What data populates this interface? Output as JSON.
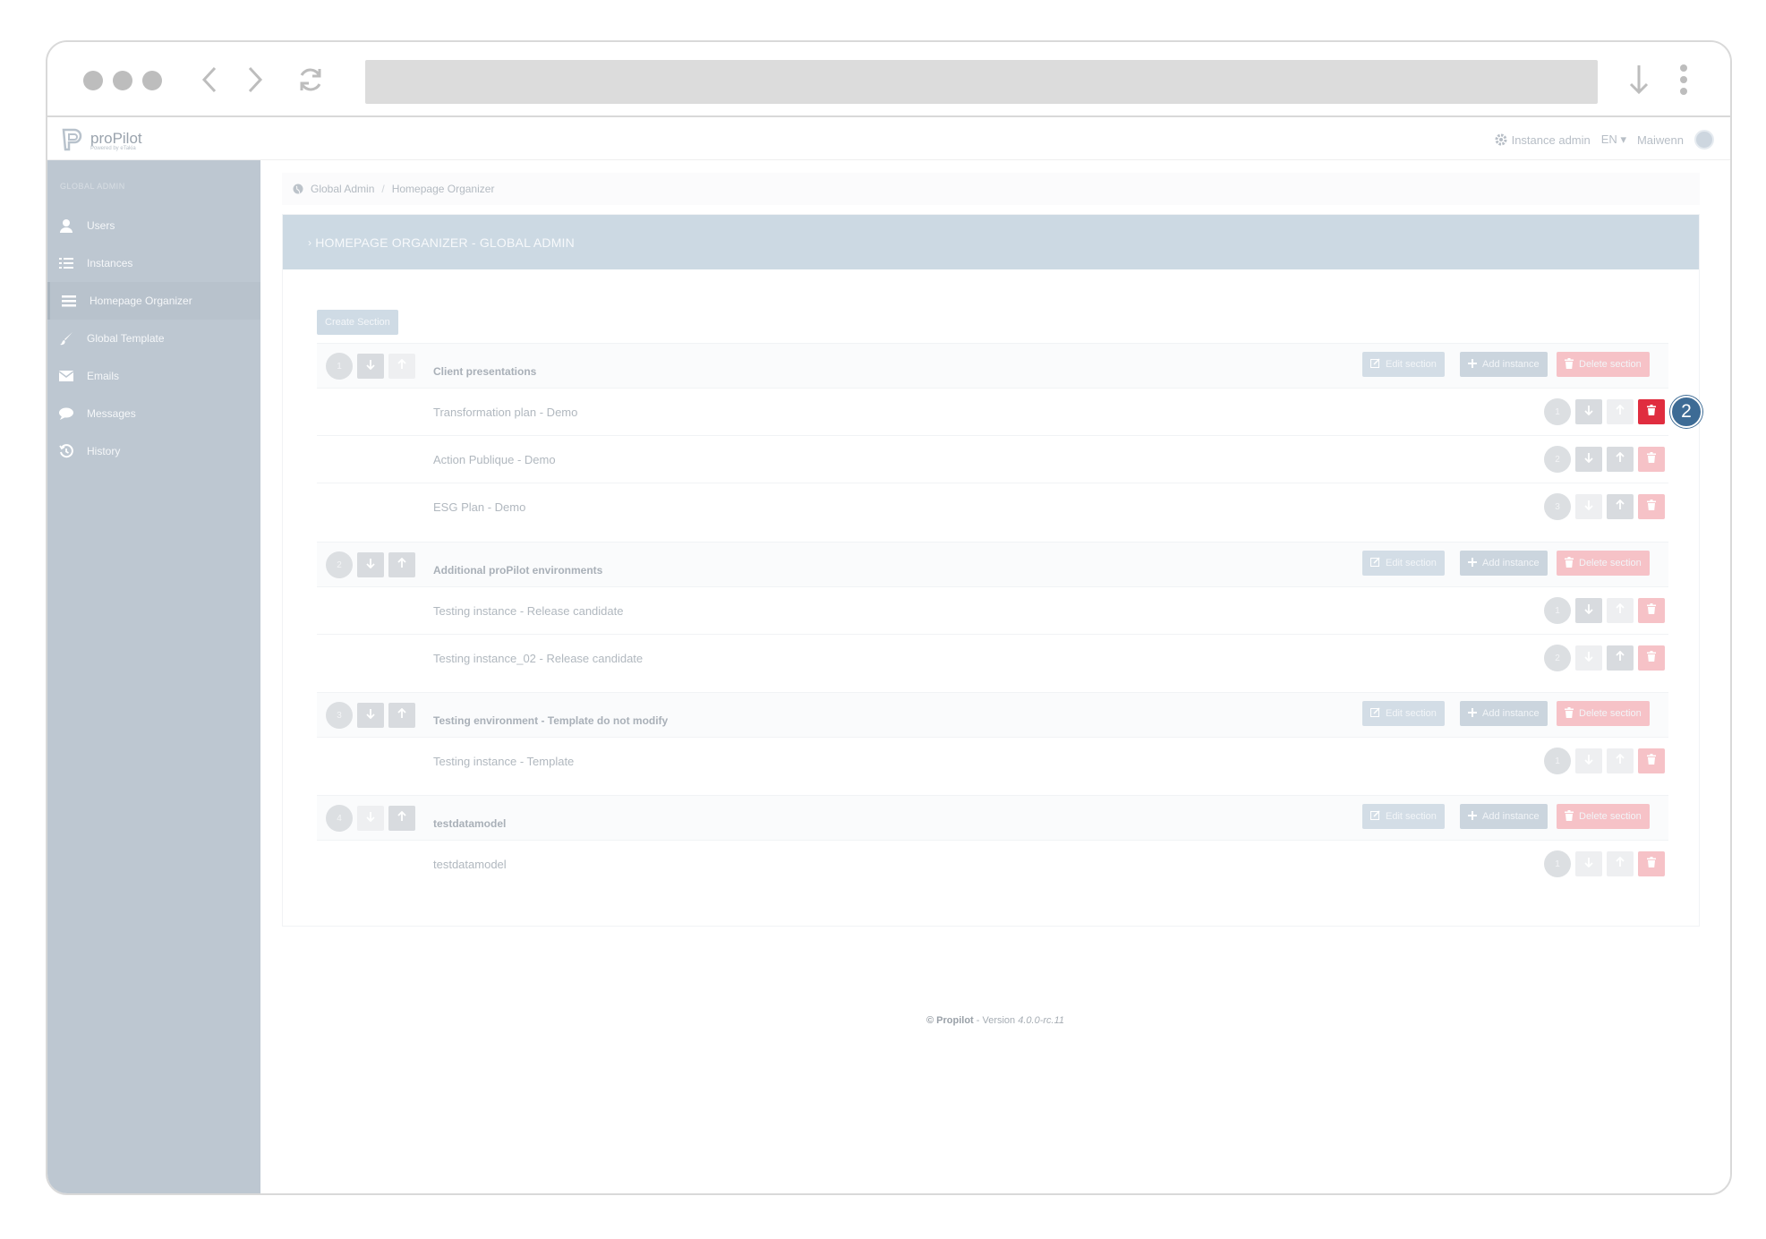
{
  "app": {
    "logo_text": "proPilot",
    "logo_sub": "Powered by eTakia",
    "instance_admin": "Instance admin",
    "language": "EN",
    "user": "Maiwenn"
  },
  "sidebar": {
    "title": "GLOBAL ADMIN",
    "items": [
      {
        "label": "Users",
        "icon": "user-icon"
      },
      {
        "label": "Instances",
        "icon": "list-icon"
      },
      {
        "label": "Homepage Organizer",
        "icon": "menu-icon"
      },
      {
        "label": "Global Template",
        "icon": "brush-icon"
      },
      {
        "label": "Emails",
        "icon": "envelope-icon"
      },
      {
        "label": "Messages",
        "icon": "comment-icon"
      },
      {
        "label": "History",
        "icon": "history-icon"
      }
    ]
  },
  "breadcrumb": [
    "Global Admin",
    "Homepage Organizer"
  ],
  "page": {
    "header": "HOMEPAGE ORGANIZER - GLOBAL ADMIN",
    "create_section": "Create Section",
    "edit_section": "Edit section",
    "add_instance": "Add instance",
    "delete_section": "Delete section"
  },
  "sections": [
    {
      "number": "1",
      "title": "Client presentations",
      "instances": [
        {
          "number": "1",
          "name": "Transformation plan - Demo"
        },
        {
          "number": "2",
          "name": "Action Publique - Demo"
        },
        {
          "number": "3",
          "name": "ESG Plan - Demo"
        }
      ]
    },
    {
      "number": "2",
      "title": "Additional proPilot environments",
      "instances": [
        {
          "number": "1",
          "name": "Testing instance - Release candidate"
        },
        {
          "number": "2",
          "name": "Testing instance_02 - Release candidate"
        }
      ]
    },
    {
      "number": "3",
      "title": "Testing environment - Template do not modify",
      "instances": [
        {
          "number": "1",
          "name": "Testing instance - Template"
        }
      ]
    },
    {
      "number": "4",
      "title": "testdatamodel",
      "instances": [
        {
          "number": "1",
          "name": "testdatamodel"
        }
      ]
    }
  ],
  "callout": "2",
  "footer": {
    "brand": "© Propilot",
    "sep": " - Version ",
    "version": "4.0.0-rc.11"
  },
  "colors": {
    "delete_active": "#e02d3f",
    "callout": "#3d6b95",
    "sidebar": "#bdc7d1"
  }
}
